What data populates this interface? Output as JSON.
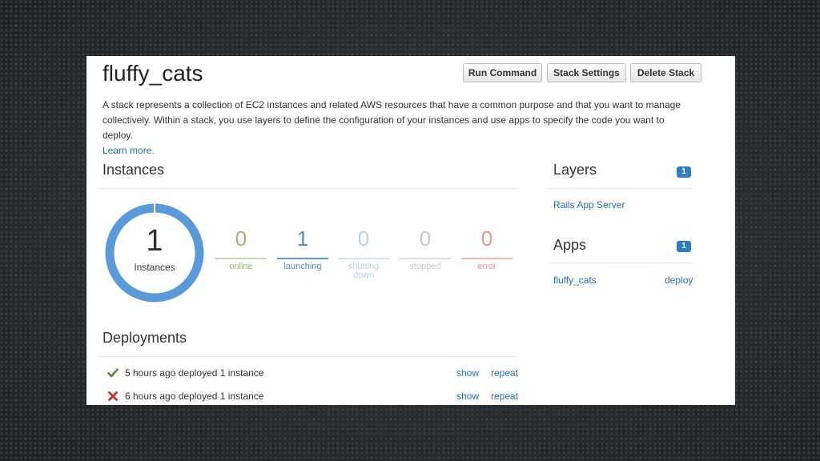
{
  "stack": {
    "title": "fluffy_cats",
    "description": "A stack represents a collection of EC2 instances and related AWS resources that have a common purpose and that you want to manage collectively. Within a stack, you use layers to define the configuration of your instances and use apps to specify the code you want to deploy.",
    "learn_more": "Learn more."
  },
  "toolbar": {
    "run_command": "Run Command",
    "stack_settings": "Stack Settings",
    "delete_stack": "Delete Stack"
  },
  "instances": {
    "title": "Instances",
    "total": "1",
    "total_label": "Instances",
    "stats": [
      {
        "value": "0",
        "label": "online",
        "color": "#9cba72",
        "bar": "#c5d8ae"
      },
      {
        "value": "1",
        "label": "launching",
        "color": "#4a8fd4",
        "bar": "#5b9ad9"
      },
      {
        "value": "0",
        "label": "shutting down",
        "color": "#b9d3ea",
        "bar": "#d6e5f3"
      },
      {
        "value": "0",
        "label": "stopped",
        "color": "#c9c9c9",
        "bar": "#dddddd"
      },
      {
        "value": "0",
        "label": "error",
        "color": "#e8958a",
        "bar": "#f1b9b1"
      }
    ],
    "donut_color": "#5b9ad9"
  },
  "deployments": {
    "title": "Deployments",
    "rows": [
      {
        "status": "success",
        "text": "5 hours ago deployed 1 instance",
        "show": "show",
        "repeat": "repeat"
      },
      {
        "status": "failed",
        "text": "6 hours ago deployed 1 instance",
        "show": "show",
        "repeat": "repeat"
      }
    ],
    "icons": {
      "success": "check-icon",
      "failed": "x-icon"
    }
  },
  "layers": {
    "title": "Layers",
    "count": "1",
    "items": [
      "Rails App Server"
    ]
  },
  "apps": {
    "title": "Apps",
    "count": "1",
    "items": [
      {
        "name": "fluffy_cats",
        "action": "deploy"
      }
    ]
  }
}
